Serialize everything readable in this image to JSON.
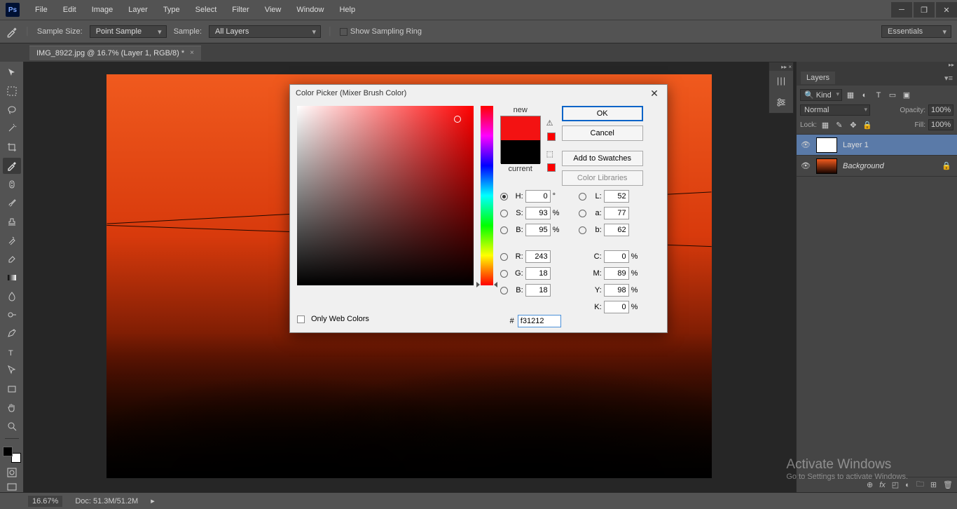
{
  "menu": [
    "File",
    "Edit",
    "Image",
    "Layer",
    "Type",
    "Select",
    "Filter",
    "View",
    "Window",
    "Help"
  ],
  "optbar": {
    "sample_size_label": "Sample Size:",
    "sample_size_value": "Point Sample",
    "sample_label": "Sample:",
    "sample_value": "All Layers",
    "show_ring": "Show Sampling Ring",
    "workspace": "Essentials"
  },
  "doc_tab": "IMG_8922.jpg @ 16.7% (Layer 1, RGB/8) *",
  "statusbar": {
    "zoom": "16.67%",
    "doc": "Doc: 51.3M/51.2M"
  },
  "watermark": {
    "title": "Activate Windows",
    "sub": "Go to Settings to activate Windows."
  },
  "layers_panel": {
    "title": "Layers",
    "kind": "Kind",
    "blend": "Normal",
    "opacity_label": "Opacity:",
    "opacity": "100%",
    "lock_label": "Lock:",
    "fill_label": "Fill:",
    "fill": "100%",
    "items": [
      {
        "name": "Layer 1",
        "locked": false,
        "selected": true,
        "thumb": "white"
      },
      {
        "name": "Background",
        "locked": true,
        "selected": false,
        "thumb": "sunset"
      }
    ]
  },
  "dialog": {
    "title": "Color Picker (Mixer Brush Color)",
    "new": "new",
    "current": "current",
    "ok": "OK",
    "cancel": "Cancel",
    "add": "Add to Swatches",
    "lib": "Color Libraries",
    "owc": "Only Web Colors",
    "vals": {
      "H": "0",
      "S": "93",
      "B": "95",
      "R": "243",
      "G": "18",
      "Bb": "18",
      "L": "52",
      "a": "77",
      "b": "62",
      "C": "0",
      "M": "89",
      "Y": "98",
      "K": "0",
      "hex": "f31212"
    },
    "labels": {
      "H": "H:",
      "S": "S:",
      "B": "B:",
      "R": "R:",
      "G": "G:",
      "Bb": "B:",
      "L": "L:",
      "a": "a:",
      "b": "b:",
      "C": "C:",
      "M": "M:",
      "Y": "Y:",
      "K": "K:",
      "deg": "°",
      "pct": "%",
      "hash": "#"
    }
  }
}
